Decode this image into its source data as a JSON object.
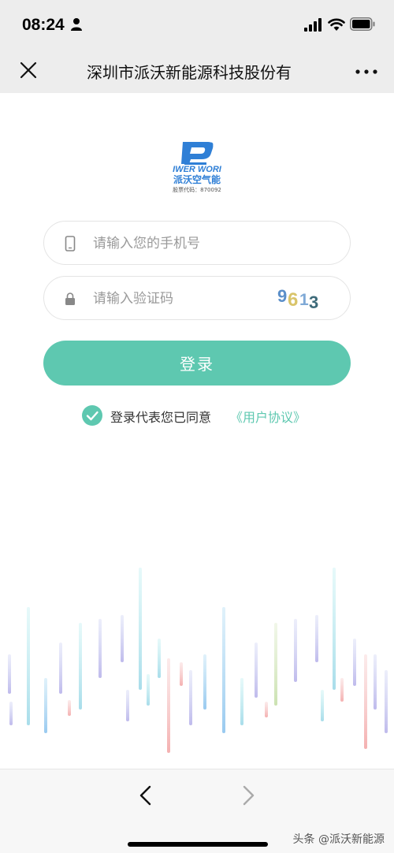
{
  "status_bar": {
    "time": "08:24",
    "icons": [
      "person-icon",
      "signal-icon",
      "wifi-icon",
      "battery-icon"
    ]
  },
  "nav": {
    "title": "深圳市派沃新能源科技股份有",
    "close_icon": "close-icon",
    "more_icon": "more-icon"
  },
  "logo": {
    "brand_en": "IWER WORI",
    "brand_cn": "派沃空气能",
    "stock": "股票代码：870092"
  },
  "form": {
    "phone_placeholder": "请输入您的手机号",
    "code_placeholder": "请输入验证码",
    "captcha_text": "9613",
    "login_label": "登录"
  },
  "agreement": {
    "checked": true,
    "text": "登录代表您已同意",
    "link": "《用户协议》"
  },
  "bottom_bar": {
    "back_icon": "back-icon",
    "forward_icon": "forward-icon",
    "watermark": "头条 @派沃新能源"
  },
  "colors": {
    "accent": "#5ec8b0",
    "brand_blue": "#2f7fd6",
    "bar_bg": "#ededed"
  }
}
